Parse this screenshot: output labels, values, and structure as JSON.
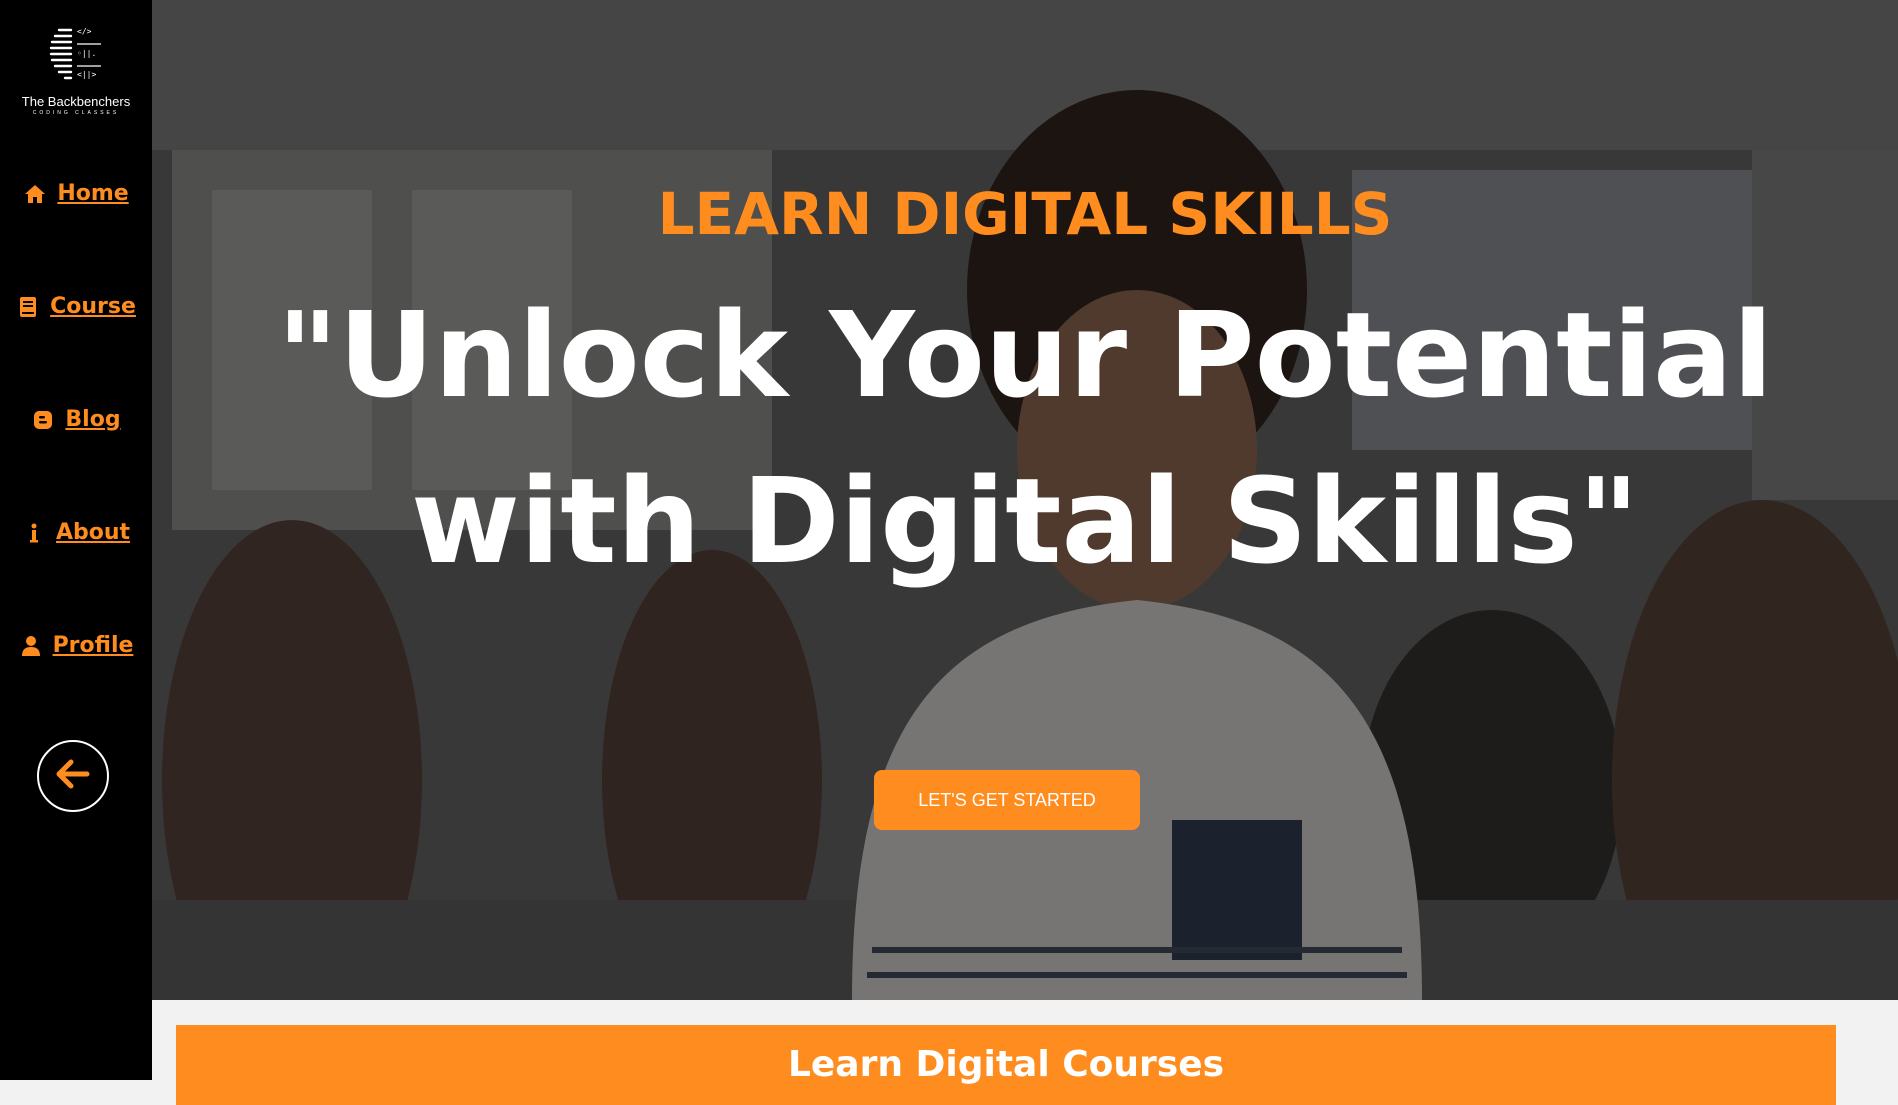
{
  "brand": {
    "name": "The Backbenchers",
    "tagline": "CODING CLASSES"
  },
  "nav": {
    "items": [
      {
        "label": "Home",
        "icon": "home-icon"
      },
      {
        "label": "Course",
        "icon": "book-icon"
      },
      {
        "label": "Blog",
        "icon": "blogger-icon"
      },
      {
        "label": "About",
        "icon": "info-icon"
      },
      {
        "label": "Profile",
        "icon": "user-icon"
      }
    ],
    "collapse_icon": "arrow-left-icon"
  },
  "hero": {
    "kicker": "LEARN DIGITAL SKILLS",
    "headline": "\"Unlock Your Potential with Digital Skills\"",
    "cta_label": "LET'S GET STARTED",
    "background": "classroom-student-photo"
  },
  "section": {
    "title": "Learn Digital Courses"
  },
  "colors": {
    "accent": "#ff8c1e",
    "sidebar": "#000000",
    "text_light": "#ffffff"
  }
}
